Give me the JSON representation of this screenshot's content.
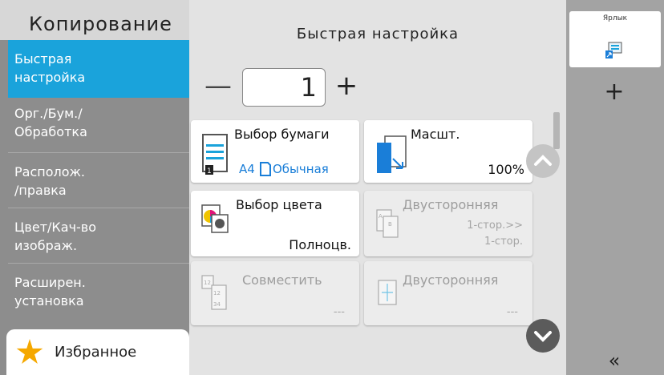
{
  "sidebar": {
    "title": "Копирование",
    "items": [
      {
        "line1": "Быстрая",
        "line2": "настройка"
      },
      {
        "line1": "Орг./Бум./",
        "line2": "Обработка"
      },
      {
        "line1": "Располож.",
        "line2": "/правка"
      },
      {
        "line1": "Цвет/Кач-во",
        "line2": "изображ."
      },
      {
        "line1": "Расширен.",
        "line2": "установка"
      }
    ],
    "favorites": "Избранное"
  },
  "main": {
    "title": "Быстрая настройка",
    "copies": "1",
    "minus": "—",
    "plus": "+",
    "tiles": {
      "paper": {
        "title": "Выбор бумаги",
        "size": "A4",
        "type": "Обычная"
      },
      "zoom": {
        "title": "Масшт.",
        "value": "100%"
      },
      "color": {
        "title": "Выбор цвета",
        "value": "Полноцв."
      },
      "duplex": {
        "title": "Двусторонняя",
        "line1": "1-стор.>>",
        "line2": "1-стор."
      },
      "combine": {
        "title": "Совместить",
        "value": "---"
      },
      "duplex2": {
        "title": "Двусторонняя",
        "value": "---"
      }
    }
  },
  "right": {
    "shortcut_label": "Ярлык",
    "add": "+",
    "collapse": "«"
  },
  "colors": {
    "accent": "#1aa3db",
    "sidebar": "#8d8d8d",
    "main_bg": "#e3e3e3",
    "right_bg": "#a3a3a3",
    "favorite_star": "#f5a800"
  }
}
